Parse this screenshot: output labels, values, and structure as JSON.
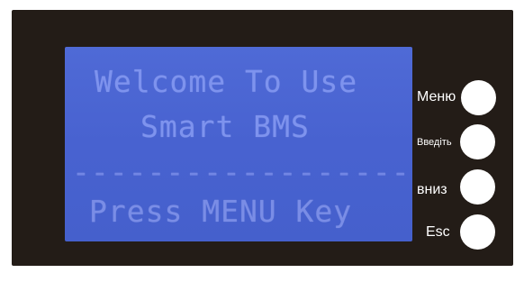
{
  "lcd": {
    "line1": "Welcome To Use",
    "line2": "Smart BMS",
    "line3": "---------------------",
    "line4": "Press MENU Key"
  },
  "buttons": {
    "menu_label": "Меню",
    "enter_label": "Введіть",
    "down_label": "вниз",
    "esc_label": "Esc"
  },
  "colors": {
    "panel": "#231c17",
    "lcd_background": "#4f6ad6",
    "lcd_text": "#7e93ee",
    "button": "#ffffff"
  }
}
